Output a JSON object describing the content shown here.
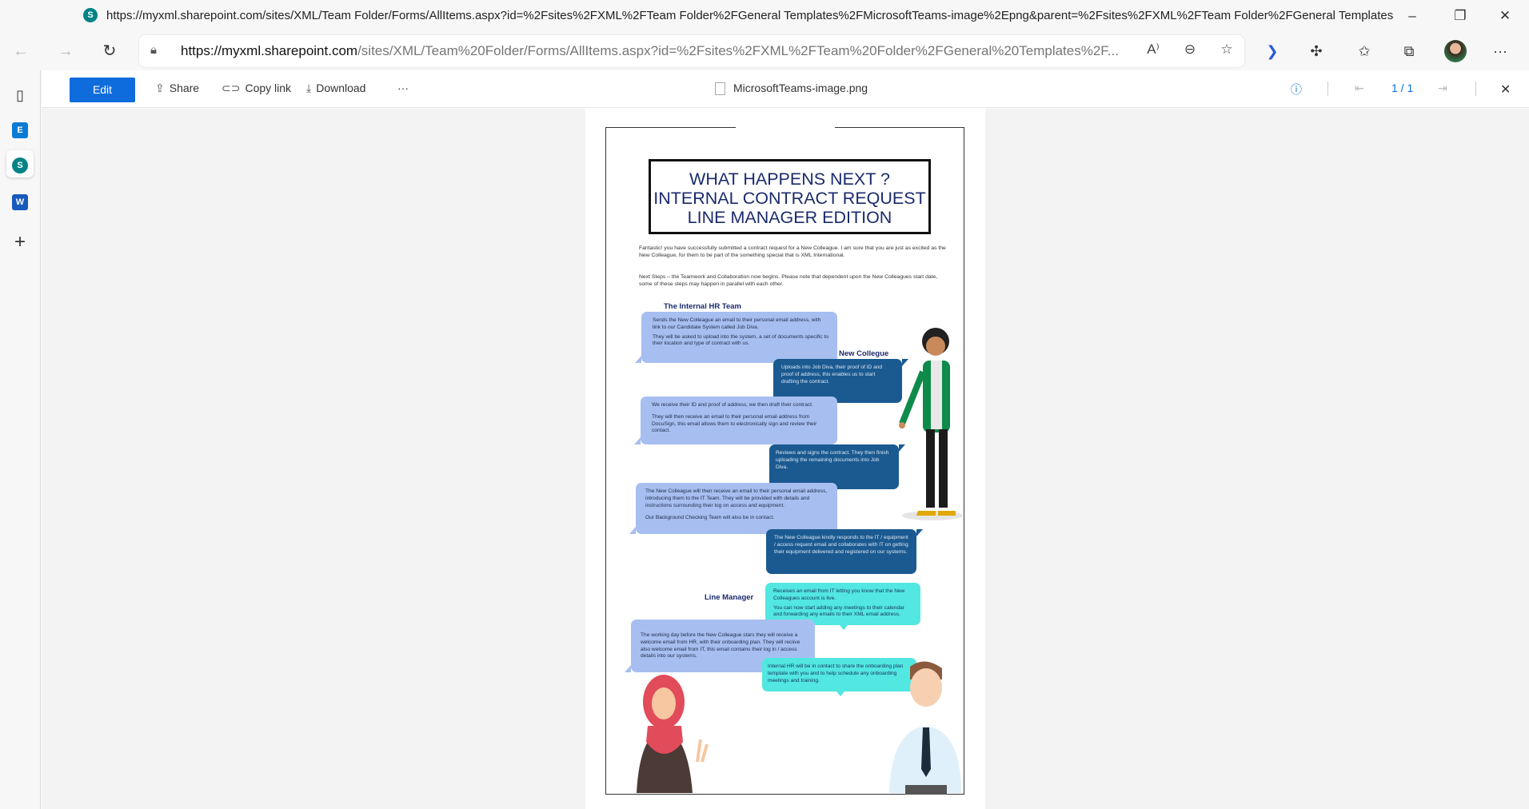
{
  "browser": {
    "title_url": "https://myxml.sharepoint.com/sites/XML/Team Folder/Forms/AllItems.aspx?id=%2Fsites%2FXML%2FTeam Folder%2FGeneral Templates%2FMicrosoftTeams-image%2Epng&parent=%2Fsites%2FXML%2FTeam Folder%2FGeneral Templates&p=...",
    "address_host": "https://myxml.sharepoint.com",
    "address_path": "/sites/XML/Team%20Folder/Forms/AllItems.aspx?id=%2Fsites%2FXML%2FTeam%20Folder%2FGeneral%20Templates%2F...",
    "icons": [
      "sharepoint-icon",
      "back-icon",
      "forward-icon",
      "refresh-icon",
      "lock-icon",
      "read-aloud-icon",
      "zoom-out-icon",
      "favorite-add-icon",
      "copilot-icon",
      "extensions-icon",
      "favorites-icon",
      "collections-icon",
      "avatar",
      "more-icon"
    ]
  },
  "sidebar": {
    "items": [
      {
        "name": "tabs"
      },
      {
        "name": "exchange",
        "label": "E"
      },
      {
        "name": "sharepoint",
        "label": "S"
      },
      {
        "name": "word",
        "label": "W"
      },
      {
        "name": "add",
        "label": "+"
      }
    ]
  },
  "toolbar": {
    "edit": "Edit",
    "share": "Share",
    "copy_link": "Copy link",
    "download": "Download",
    "more": "···",
    "filename": "MicrosoftTeams-image.png",
    "page_counter": "1 / 1"
  },
  "infographic": {
    "title_lines": [
      "WHAT HAPPENS NEXT ?",
      "INTERNAL CONTRACT REQUEST",
      "LINE MANAGER EDITION"
    ],
    "intro": [
      "Fantastic! you have successfully submitted a contract request for a New Colleague. I am sure that you are just as excited as the New Colleague, for them to be part of the something special that is XML International.",
      "Next Steps – the Teamwork and Collaboration now begins. Please note that dependent upon the New Colleagues start date, some of these steps may happen in parallel with each other."
    ],
    "labels": {
      "hr": "The Internal HR Team",
      "colleague": "New Collegue",
      "manager": "Line Manager"
    },
    "bubbles": {
      "hr1": [
        "Sends the New Colleague an email to their personal email address, with link to our Candidate System called Job Diva.",
        "They will be asked to upload into the system, a set of documents specific to their location and type of contract with us."
      ],
      "nc1": "Uploads into Job Diva, their proof of ID and proof of address, this enables us to start drafting the contract.",
      "hr2": [
        "We receive their ID and proof of address, we then draft their contract.",
        "They will then receive an email to their personal email address from DocuSign, this email allows them to electronically sign and review their contact."
      ],
      "nc2": "Reviews and signs the contract. They then finish uploading the remaining documents into Job Diva.",
      "hr3": [
        "The New Colleague will then receive an email to their personal email address, introducing them to the IT Team. They will be provided with details and instructions surrounding their log on access and equipment.",
        "Our Background Checking Team will also be in contact."
      ],
      "nc3": "The New Colleague kindly responds to the IT / equipment / access request email and collaborates with IT on getting their equipment delivered and registered on our systems.",
      "lm1": [
        "Receives an email from IT letting you know that the New Colleagues  account is live.",
        "You can now start adding any meetings to their calendar and forwarding any emails to their XML email address."
      ],
      "hr4": "The working day before the New Colleague stars they will receive a welcome email from HR, with their onboarding plan.  They will reciive also welcome email from IT, this email contains their log in / access details into our systems.",
      "lm2": "Internal HR will be in contact to share the onboarding plan template with you and to help schedule any onboarding meetings and training."
    },
    "colors": {
      "light_bubble": "#a7bff0",
      "dark_bubble": "#1b5a90",
      "cyan_bubble": "#52e7e1",
      "heading": "#1a2a6c"
    }
  },
  "colors": {
    "edit_button": "#0f6cdd"
  }
}
